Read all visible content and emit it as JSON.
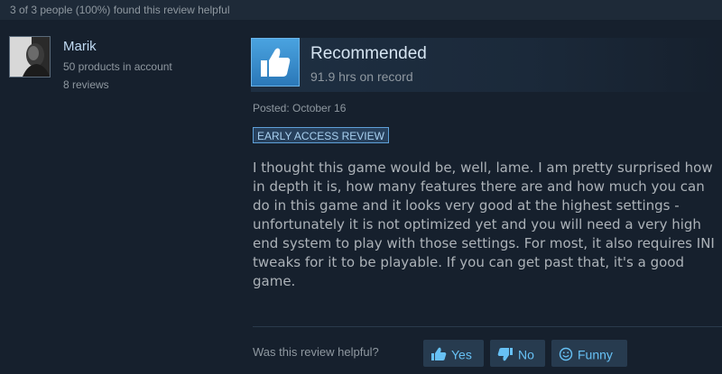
{
  "helpful_summary": "3 of 3 people (100%) found this review helpful",
  "author": {
    "name": "Marik",
    "products": "50 products in account",
    "reviews": "8 reviews"
  },
  "review": {
    "verdict": "Recommended",
    "hours": "91.9 hrs on record",
    "posted": "Posted: October 16",
    "badge": "EARLY ACCESS REVIEW",
    "body": "I thought this game would be, well, lame. I am pretty surprised how in depth it is, how many features there are and how much you can do in this game and it looks very good at the highest settings - unfortunately it is not optimized yet and you will need a very high end system to play with those settings. For most, it also requires INI tweaks for it to be playable. If you can get past that, it's a good game."
  },
  "feedback": {
    "question": "Was this review helpful?",
    "yes_label": "Yes",
    "no_label": "No",
    "funny_label": "Funny"
  },
  "icons": {
    "thumbs_up": "thumbs-up-icon",
    "thumbs_down": "thumbs-down-icon",
    "smiley": "smiley-icon"
  },
  "colors": {
    "background": "#16202d",
    "accent_blue": "#67c1f5",
    "thumb_box": "#3e8fd0"
  }
}
